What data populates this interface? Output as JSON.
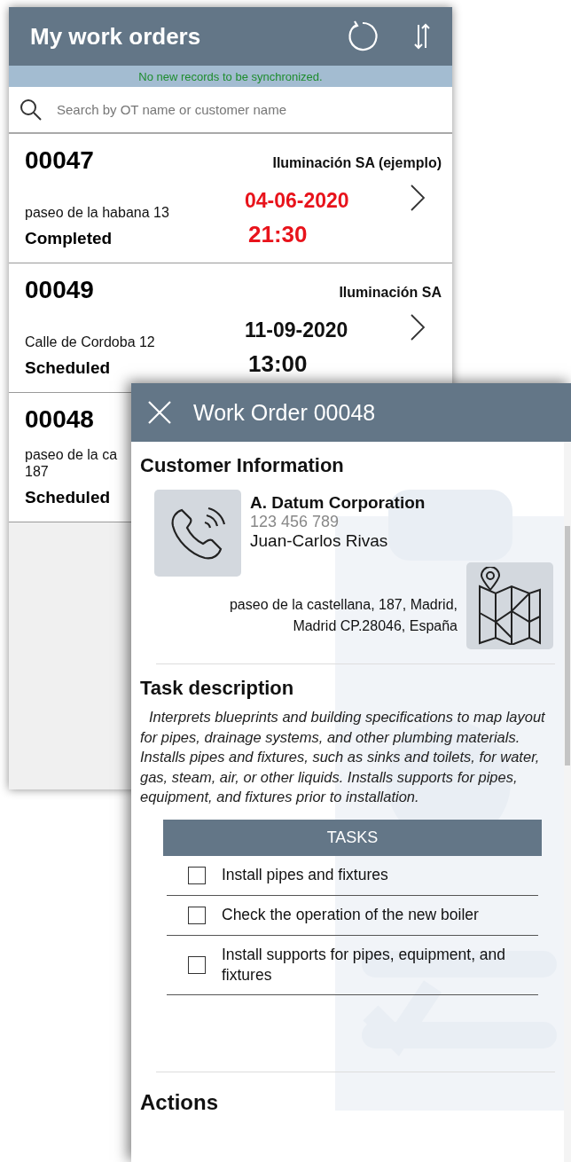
{
  "list": {
    "title": "My work orders",
    "sync_message": "No new records to be synchronized.",
    "search": {
      "placeholder": "Search by OT name or customer name"
    },
    "orders": [
      {
        "number": "00047",
        "customer": "Iluminación SA (ejemplo)",
        "address_lines": [
          "paseo de la habana 13"
        ],
        "date": "04-06-2020",
        "time": "21:30",
        "status": "Completed",
        "overdue": true
      },
      {
        "number": "00049",
        "customer": "Iluminación SA",
        "address_lines": [
          "Calle de Cordoba 12"
        ],
        "date": "11-09-2020",
        "time": "13:00",
        "status": "Scheduled",
        "overdue": false
      },
      {
        "number": "00048",
        "address_lines": [
          "paseo de la ca",
          "187"
        ],
        "status": "Scheduled"
      }
    ]
  },
  "detail": {
    "title": "Work Order 00048",
    "customer_section": {
      "heading": "Customer Information",
      "name": "A. Datum Corporation",
      "phone": "123 456 789",
      "contact": "Juan-Carlos Rivas",
      "address_lines": [
        "paseo de la castellana, 187, Madrid,",
        "Madrid CP.28046, España"
      ]
    },
    "task_section": {
      "heading": "Task description",
      "description": "Interprets blueprints and building specifications to map layout for pipes, drainage systems, and other plumbing materials. Installs pipes and fixtures, such as sinks and toilets, for water, gas, steam, air, or other liquids. Installs supports for pipes, equipment, and fixtures prior to installation.",
      "tasks_heading": "TASKS",
      "tasks": [
        {
          "label": "Install pipes and fixtures",
          "checked": false
        },
        {
          "label": "Check the operation of the new boiler",
          "checked": false
        },
        {
          "label": "Install supports for pipes, equipment, and fixtures",
          "checked": false
        }
      ]
    },
    "actions_heading": "Actions"
  }
}
